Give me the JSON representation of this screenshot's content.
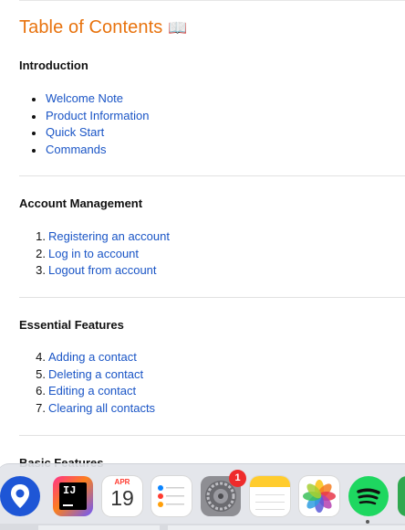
{
  "title": "Table of Contents",
  "title_icon": "book-icon",
  "sections": [
    {
      "title": "Introduction",
      "list_type": "bullet",
      "items": [
        "Welcome Note",
        "Product Information",
        "Quick Start",
        "Commands"
      ]
    },
    {
      "title": "Account Management",
      "list_type": "numbered",
      "items": [
        {
          "num": "1",
          "label": "Registering an account"
        },
        {
          "num": "2",
          "label": "Log in to account"
        },
        {
          "num": "3",
          "label": "Logout from account"
        }
      ]
    },
    {
      "title": "Essential Features",
      "list_type": "numbered",
      "items": [
        {
          "num": "4",
          "label": "Adding a contact"
        },
        {
          "num": "5",
          "label": "Deleting a contact"
        },
        {
          "num": "6",
          "label": "Editing a contact"
        },
        {
          "num": "7",
          "label": "Clearing all contacts"
        }
      ]
    },
    {
      "title": "Basic Features",
      "list_type": "numbered",
      "items": []
    }
  ],
  "dock": {
    "apps": [
      {
        "name": "location-app-icon"
      },
      {
        "name": "intellij-icon",
        "label": "IJ"
      },
      {
        "name": "calendar-icon",
        "month": "APR",
        "day": "19"
      },
      {
        "name": "reminders-icon"
      },
      {
        "name": "system-settings-icon",
        "badge": "1"
      },
      {
        "name": "notes-icon"
      },
      {
        "name": "photos-icon"
      },
      {
        "name": "spotify-icon"
      },
      {
        "name": "partial-app-icon"
      }
    ]
  },
  "colors": {
    "heading": "#e8730e",
    "link": "#1a55c6"
  }
}
